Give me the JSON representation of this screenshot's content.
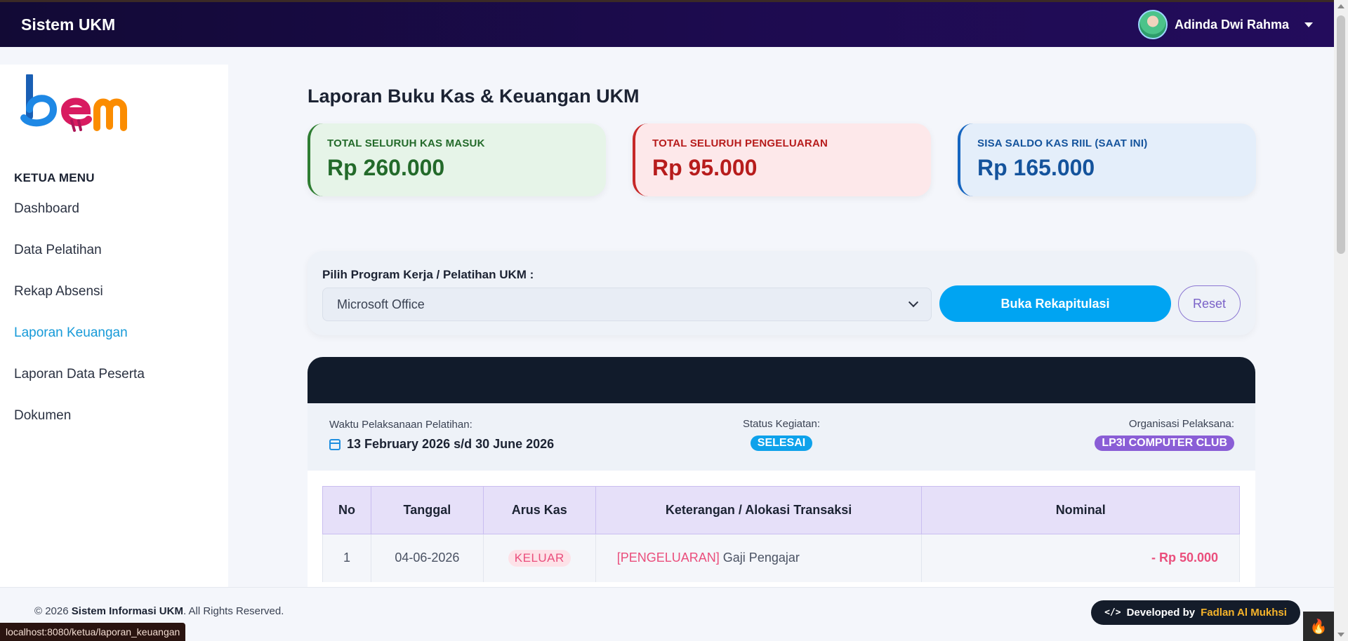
{
  "navbar": {
    "brand": "Sistem UKM",
    "user_name": "Adinda Dwi Rahma"
  },
  "sidebar": {
    "logo_text": "bem",
    "menu_title": "KETUA MENU",
    "items": [
      {
        "label": "Dashboard"
      },
      {
        "label": "Data Pelatihan"
      },
      {
        "label": "Rekap Absensi"
      },
      {
        "label": "Laporan Keuangan"
      },
      {
        "label": "Laporan Data Peserta"
      },
      {
        "label": "Dokumen"
      }
    ],
    "active_item": "Laporan Keuangan"
  },
  "page": {
    "title": "Laporan Buku Kas & Keuangan UKM"
  },
  "stats": {
    "kas_masuk": {
      "label": "TOTAL SELURUH KAS MASUK",
      "value": "Rp 260.000"
    },
    "pengeluaran": {
      "label": "TOTAL SELURUH PENGELUARAN",
      "value": "Rp 95.000"
    },
    "saldo": {
      "label": "SISA SALDO KAS RIIL (SAAT INI)",
      "value": "Rp 165.000"
    }
  },
  "filter": {
    "label": "Pilih Program Kerja / Pelatihan UKM :",
    "selected": "Microsoft Office",
    "open_button": "Buka Rekapitulasi",
    "reset_button": "Reset"
  },
  "detail": {
    "time_label": "Waktu Pelaksanaan Pelatihan:",
    "time_value": "13 February 2026 s/d 30 June 2026",
    "status_label": "Status Kegiatan:",
    "status_value": "SELESAI",
    "org_label": "Organisasi Pelaksana:",
    "org_value": "LP3I COMPUTER CLUB"
  },
  "table": {
    "headers": [
      "No",
      "Tanggal",
      "Arus Kas",
      "Keterangan / Alokasi Transaksi",
      "Nominal"
    ],
    "rows": [
      {
        "no": "1",
        "tanggal": "04-06-2026",
        "arus": "KELUAR",
        "tag": "[PENGELUARAN]",
        "keterangan": "Gaji Pengajar",
        "nominal": "- Rp 50.000"
      }
    ]
  },
  "footer": {
    "copyright_prefix": "© 2026",
    "copyright_name": "Sistem Informasi UKM",
    "copyright_suffix": ". All Rights Reserved.",
    "dev_label": "Developed by",
    "dev_name": "Fadlan Al Mukhsi"
  },
  "status_url": "localhost:8080/ketua/laporan_keuangan",
  "colors": {
    "accent": "#00a4f2",
    "navbar": "#1d0b4f",
    "income": "#236a2a",
    "expense": "#b71c1c",
    "balance": "#14539c"
  }
}
